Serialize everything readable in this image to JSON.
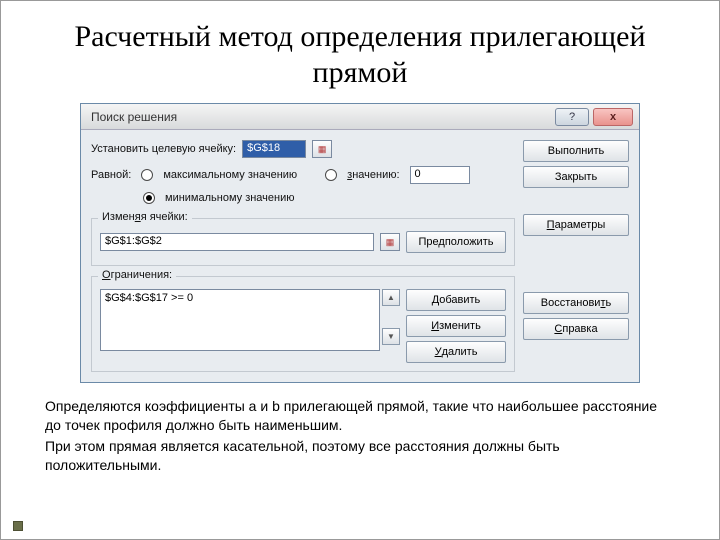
{
  "slide": {
    "title": "Расчетный метод определения прилегающей прямой",
    "caption1": "Определяются коэффициенты a и b прилегающей прямой, такие что наибольшее расстояние до точек профиля должно быть наименьшим.",
    "caption2": "При этом прямая является касательной, поэтому все расстояния должны быть положительными."
  },
  "dialog": {
    "title": "Поиск решения",
    "target_label": "Установить целевую ячейку:",
    "target_value": "$G$18",
    "equal_label": "Равной:",
    "opt_max": "максимальному значению",
    "opt_val": "значению:",
    "opt_min": "минимальному значению",
    "val_input": "0",
    "changing_label": "Изменяя ячейки:",
    "changing_value": "$G$1:$G$2",
    "guess_label": "Предположить",
    "constraints_label": "Ограничения:",
    "constraint_item": "$G$4:$G$17 >= 0"
  },
  "buttons": {
    "run": "Выполнить",
    "close": "Закрыть",
    "params": "Параметры",
    "reset": "Восстановить",
    "help": "Справка",
    "add": "Добавить",
    "edit": "Изменить",
    "delete": "Удалить"
  }
}
